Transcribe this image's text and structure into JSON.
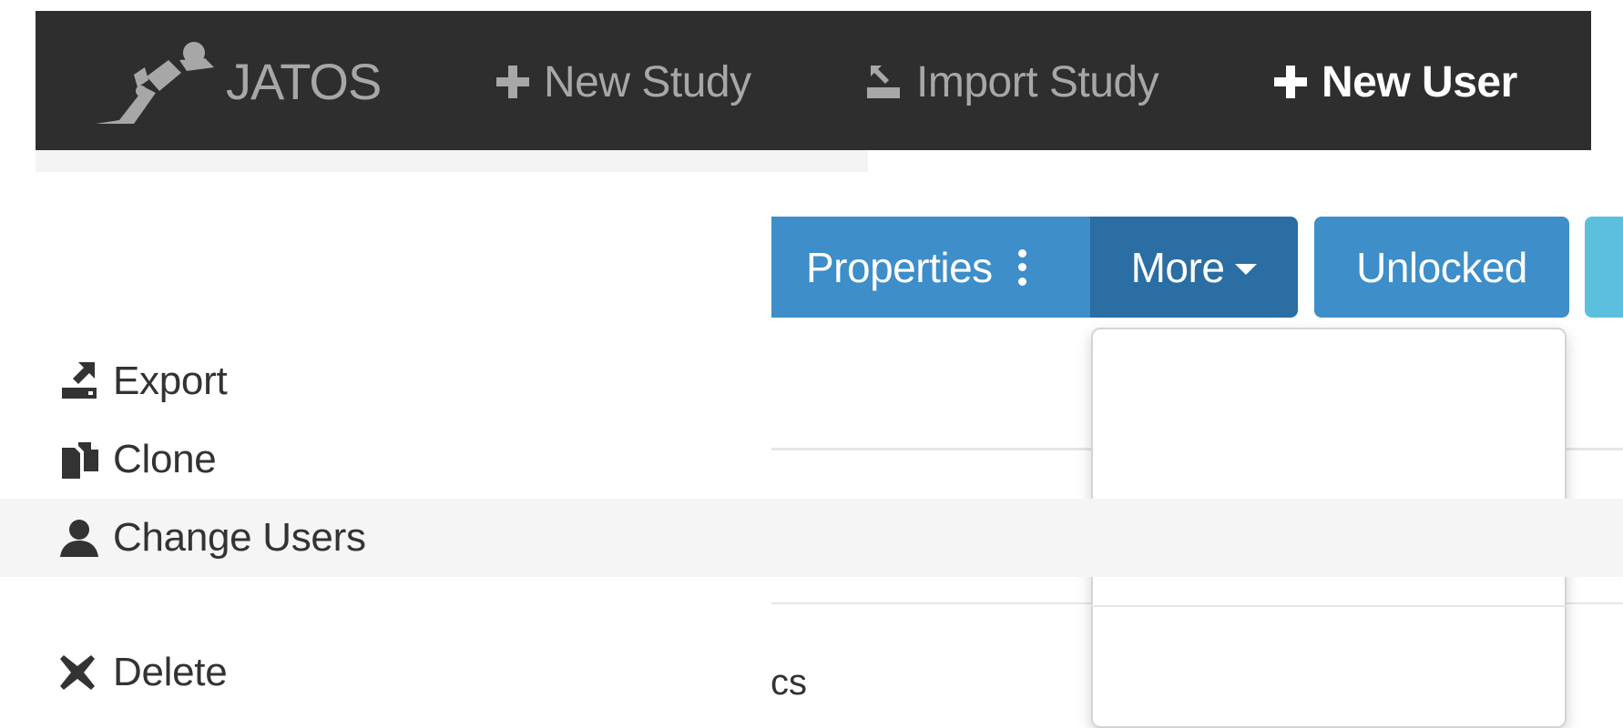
{
  "navbar": {
    "brand": "JATOS",
    "new_study": "New Study",
    "import_study": "Import Study",
    "new_user": "New User",
    "logo_icon": "jatos-logo",
    "colors": {
      "background": "#2e2e2e",
      "text": "#a7a7a7",
      "active": "#ffffff"
    }
  },
  "toolbar": {
    "properties": "Properties",
    "more": "More",
    "unlocked": "Unlocked",
    "colors": {
      "primary": "#3d8ec9",
      "pressed": "#2a6ea3",
      "info": "#5bc0de"
    }
  },
  "dropdown": {
    "items": [
      {
        "label": "Export",
        "icon": "export-icon"
      },
      {
        "label": "Clone",
        "icon": "clone-icon"
      },
      {
        "label": "Change Users",
        "icon": "user-icon"
      },
      {
        "label": "Delete",
        "icon": "delete-icon"
      }
    ]
  },
  "background": {
    "partial_text": "cs"
  }
}
